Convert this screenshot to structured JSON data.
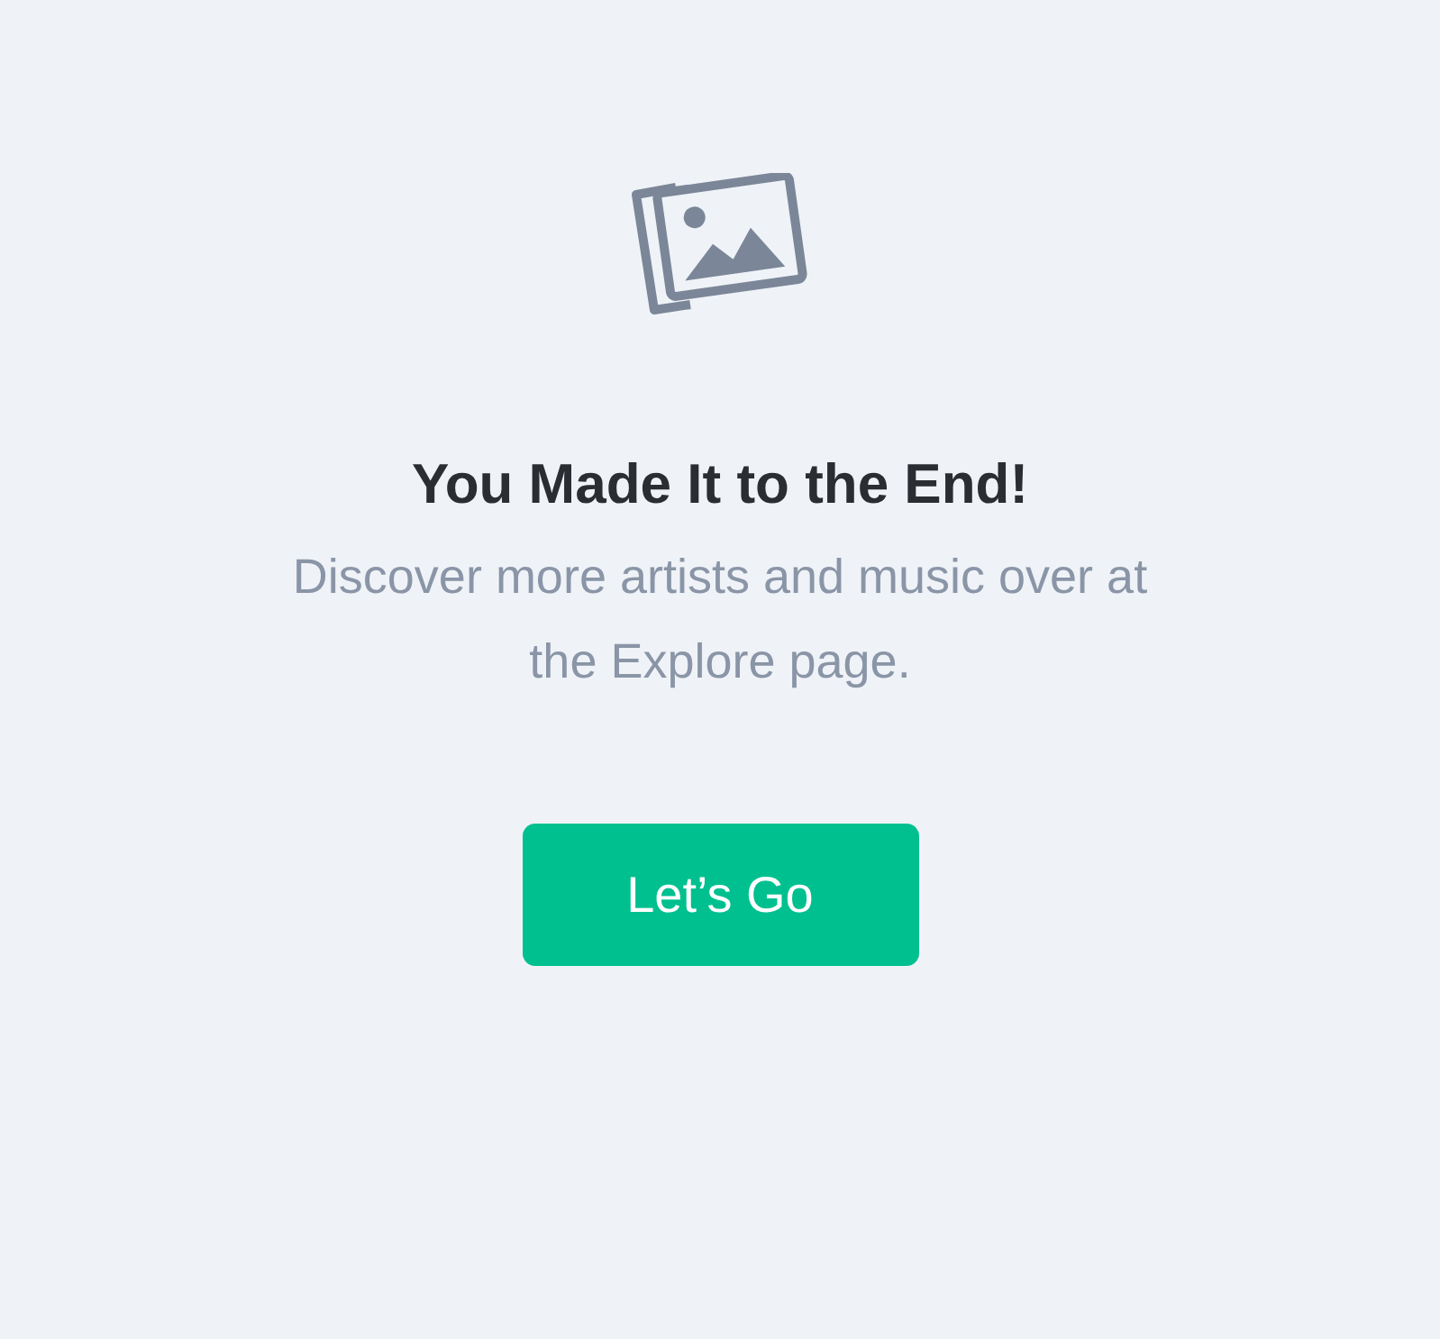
{
  "empty_state": {
    "title": "You Made It to the End!",
    "message": "Discover more artists and music over at the Explore page.",
    "button": "Let’s Go"
  }
}
